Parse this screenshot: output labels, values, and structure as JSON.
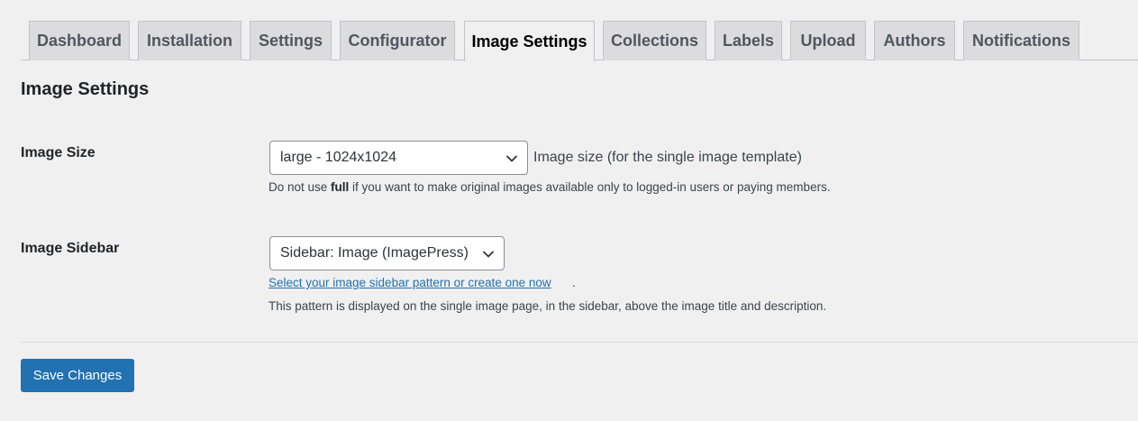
{
  "tabs": [
    {
      "label": "Dashboard",
      "active": false
    },
    {
      "label": "Installation",
      "active": false
    },
    {
      "label": "Settings",
      "active": false
    },
    {
      "label": "Configurator",
      "active": false
    },
    {
      "label": "Image Settings",
      "active": true
    },
    {
      "label": "Collections",
      "active": false
    },
    {
      "label": "Labels",
      "active": false
    },
    {
      "label": "Upload",
      "active": false
    },
    {
      "label": "Authors",
      "active": false
    },
    {
      "label": "Notifications",
      "active": false
    }
  ],
  "page_title": "Image Settings",
  "image_size": {
    "label": "Image Size",
    "selected": "large - 1024x1024",
    "inline_description": "Image size (for the single image template)",
    "note_before": "Do not use ",
    "note_bold": "full",
    "note_after": " if you want to make original images available only to logged-in users or paying members."
  },
  "image_sidebar": {
    "label": "Image Sidebar",
    "selected": "Sidebar: Image (ImagePress)",
    "link_text": "Select your image sidebar pattern or create one now",
    "link_suffix": ".",
    "description": "This pattern is displayed on the single image page, in the sidebar, above the image title and description."
  },
  "save_button": "Save Changes",
  "colors": {
    "primary": "#2271b1",
    "background": "#f0f0f1",
    "tab_inactive": "#dcdcde"
  },
  "icons": {
    "select_arrow": "chevron-down-icon"
  }
}
